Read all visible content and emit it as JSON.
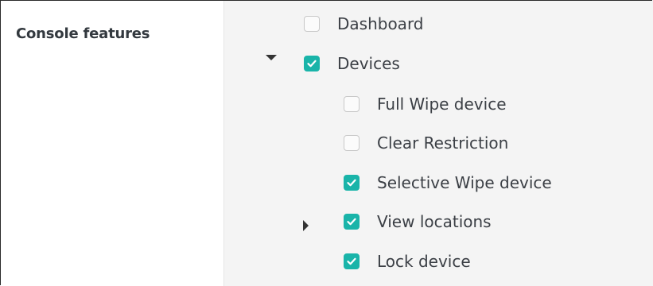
{
  "section": {
    "label": "Console features"
  },
  "features": {
    "dashboard": {
      "label": "Dashboard",
      "checked": false
    },
    "devices": {
      "label": "Devices",
      "checked": true,
      "expanded": true,
      "children": [
        {
          "label": "Full Wipe device",
          "checked": false
        },
        {
          "label": "Clear Restriction",
          "checked": false
        },
        {
          "label": "Selective Wipe device",
          "checked": true
        },
        {
          "label": "View locations",
          "checked": true,
          "expandable": true,
          "expanded": false
        },
        {
          "label": "Lock device",
          "checked": true
        }
      ]
    }
  },
  "colors": {
    "accent": "#19b4a9",
    "panel_bg": "#f4f4f4",
    "text": "#3b3f45"
  },
  "icons": {
    "checkmark": "check-icon",
    "collapse": "caret-down-icon",
    "expand": "caret-right-icon"
  }
}
